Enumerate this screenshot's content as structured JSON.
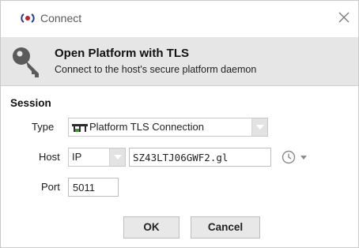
{
  "window": {
    "title": "Connect"
  },
  "banner": {
    "title": "Open Platform with TLS",
    "subtitle": "Connect to the host's secure platform daemon"
  },
  "session": {
    "section_title": "Session",
    "type_label": "Type",
    "type_value": "Platform TLS Connection",
    "host_label": "Host",
    "host_type_value": "IP",
    "host_value": "SZ43LTJ06GWF2.gl",
    "port_label": "Port",
    "port_value": "5011"
  },
  "buttons": {
    "ok_label": "OK",
    "cancel_label": "Cancel"
  }
}
